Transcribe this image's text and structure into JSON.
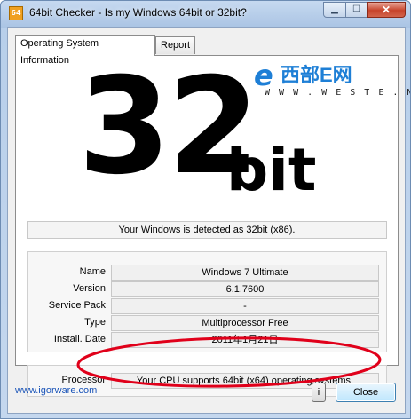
{
  "window": {
    "icon_text": "64",
    "title": "64bit Checker - Is my Windows 64bit or 32bit?",
    "controls": {
      "minimize": "▁",
      "maximize": "☐",
      "close": "✕"
    }
  },
  "tabs": [
    {
      "label": "Operating System Information",
      "active": true
    },
    {
      "label": "Report",
      "active": false
    }
  ],
  "result": {
    "big_number": "32",
    "big_suffix": "bit",
    "detected_text": "Your Windows is detected as 32bit (x86)."
  },
  "watermark": {
    "logo_mark": "e",
    "name": "西部E网",
    "url": "W W W . W E S T E . N E T"
  },
  "os_info": [
    {
      "label": "Name",
      "value": "Windows 7 Ultimate"
    },
    {
      "label": "Version",
      "value": "6.1.7600"
    },
    {
      "label": "Service Pack",
      "value": "-"
    },
    {
      "label": "Type",
      "value": "Multiprocessor Free"
    },
    {
      "label": "Install. Date",
      "value": "2011年1月21日"
    }
  ],
  "processor": {
    "label": "Processor",
    "value": "Your CPU supports 64bit (x64) operating systems."
  },
  "footer": {
    "link": "www.igorware.com",
    "info_button": "i",
    "close_button": "Close"
  },
  "colors": {
    "annotation_ring": "#e0001a",
    "watermark_blue": "#1e7fd6",
    "link": "#1a54b8"
  }
}
